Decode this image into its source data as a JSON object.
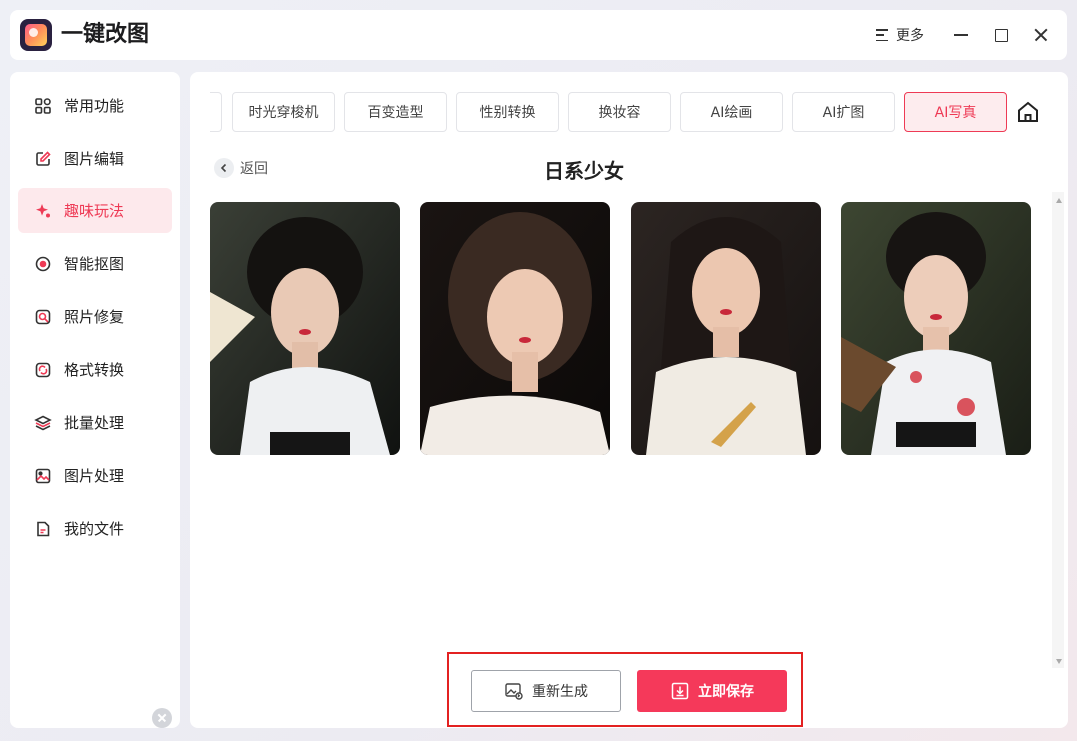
{
  "app": {
    "title": "一键改图"
  },
  "titlebar": {
    "more_label": "更多"
  },
  "sidebar": {
    "items": [
      {
        "label": "常用功能",
        "icon": "grid-icon"
      },
      {
        "label": "图片编辑",
        "icon": "edit-icon"
      },
      {
        "label": "趣味玩法",
        "icon": "sparkle-icon",
        "active": true
      },
      {
        "label": "智能抠图",
        "icon": "target-icon"
      },
      {
        "label": "照片修复",
        "icon": "repair-icon"
      },
      {
        "label": "格式转换",
        "icon": "convert-icon"
      },
      {
        "label": "批量处理",
        "icon": "layers-icon"
      },
      {
        "label": "图片处理",
        "icon": "image-icon"
      },
      {
        "label": "我的文件",
        "icon": "file-icon"
      }
    ]
  },
  "tabs": [
    {
      "label": "时光穿梭机"
    },
    {
      "label": "百变造型"
    },
    {
      "label": "性别转换"
    },
    {
      "label": "换妆容"
    },
    {
      "label": "AI绘画"
    },
    {
      "label": "AI扩图"
    },
    {
      "label": "AI写真",
      "active": true
    }
  ],
  "main": {
    "back_label": "返回",
    "title": "日系少女",
    "regenerate_label": "重新生成",
    "save_label": "立即保存"
  },
  "colors": {
    "accent": "#f5395a",
    "highlight_box": "#e32121"
  }
}
